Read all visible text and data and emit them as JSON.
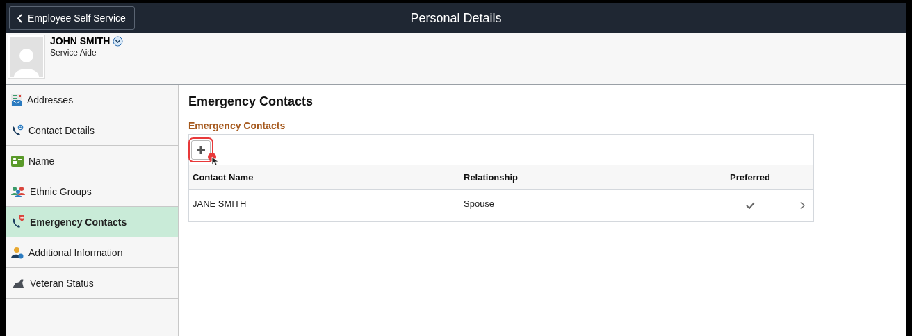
{
  "header": {
    "back_label": "Employee Self Service",
    "title": "Personal Details"
  },
  "profile": {
    "name": "JOHN SMITH",
    "job": "Service Aide"
  },
  "sidebar": {
    "items": [
      {
        "label": "Addresses",
        "selected": false
      },
      {
        "label": "Contact Details",
        "selected": false
      },
      {
        "label": "Name",
        "selected": false
      },
      {
        "label": "Ethnic Groups",
        "selected": false
      },
      {
        "label": "Emergency Contacts",
        "selected": true
      },
      {
        "label": "Additional Information",
        "selected": false
      },
      {
        "label": "Veteran Status",
        "selected": false
      }
    ]
  },
  "content": {
    "title": "Emergency Contacts",
    "section_title": "Emergency Contacts",
    "add_button": {
      "highlighted": true
    },
    "table": {
      "columns": [
        "Contact Name",
        "Relationship",
        "Preferred"
      ],
      "rows": [
        {
          "contact_name": "JANE SMITH",
          "relationship": "Spouse",
          "preferred": true
        }
      ]
    }
  }
}
